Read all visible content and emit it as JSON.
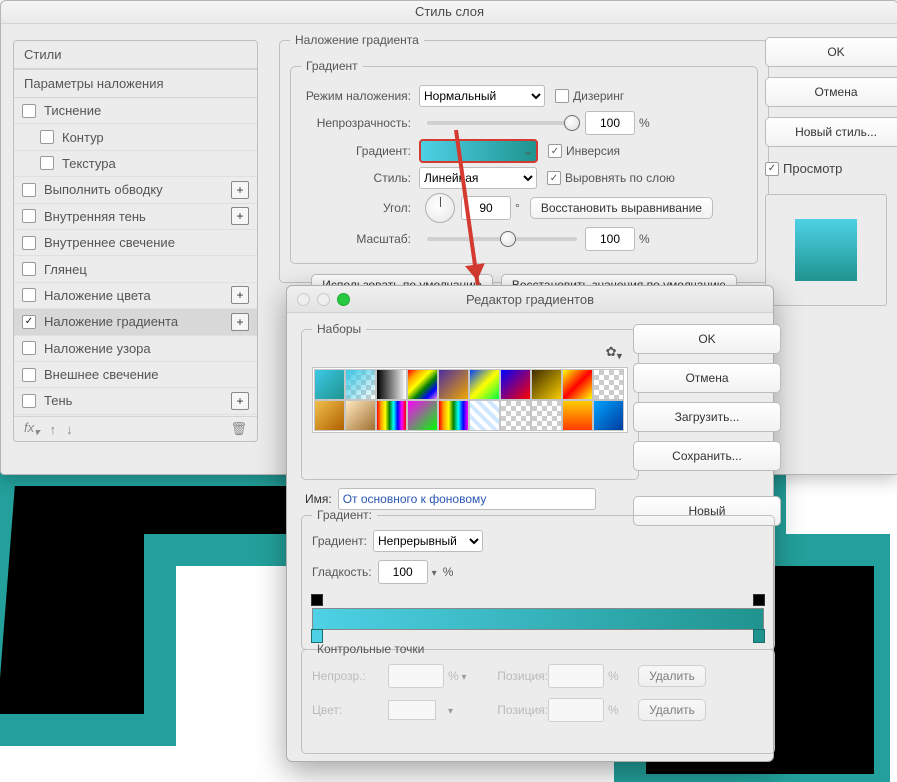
{
  "window": {
    "title": "Стиль слоя"
  },
  "styles": {
    "heading": "Стили",
    "blending": "Параметры наложения",
    "items": [
      "Тиснение",
      "Контур",
      "Текстура",
      "Выполнить обводку",
      "Внутренняя тень",
      "Внутреннее свечение",
      "Глянец",
      "Наложение цвета",
      "Наложение градиента",
      "Наложение узора",
      "Внешнее свечение",
      "Тень"
    ]
  },
  "overlay": {
    "legend": "Наложение градиента",
    "gradient_legend": "Градиент",
    "blend_label": "Режим наложения:",
    "blend_value": "Нормальный",
    "dither": "Дизеринг",
    "opacity_label": "Непрозрачность:",
    "opacity_value": "100",
    "pct": "%",
    "gradient_label": "Градиент:",
    "reverse": "Инверсия",
    "style_label": "Стиль:",
    "style_value": "Линейная",
    "align": "Выровнять по слою",
    "angle_label": "Угол:",
    "angle_value": "90",
    "deg": "°",
    "reset_align": "Восстановить выравнивание",
    "scale_label": "Масштаб:",
    "scale_value": "100",
    "make_default": "Использовать по умолчанию",
    "reset_default": "Восстановить значения по умолчанию"
  },
  "buttons": {
    "ok": "OK",
    "cancel": "Отмена",
    "new_style": "Новый стиль...",
    "preview": "Просмотр"
  },
  "editor": {
    "title": "Редактор градиентов",
    "presets_label": "Наборы",
    "ok": "OK",
    "cancel": "Отмена",
    "load": "Загрузить...",
    "save": "Сохранить...",
    "new": "Новый",
    "name_label": "Имя:",
    "name_value": "От основного к фоновому",
    "gradient_legend": "Градиент:",
    "type_inline": "Градиент:",
    "type_label": "Градиент:",
    "type_value": "Непрерывный",
    "smooth_label": "Гладкость:",
    "smooth_value": "100",
    "stops_legend": "Контрольные точки",
    "opacity_s": "Непрозр.:",
    "color_s": "Цвет:",
    "position": "Позиция:",
    "delete": "Удалить"
  },
  "colors": {
    "accent": "#d43a2f",
    "grad_from": "#4ed1e6",
    "grad_to": "#1f948f"
  }
}
